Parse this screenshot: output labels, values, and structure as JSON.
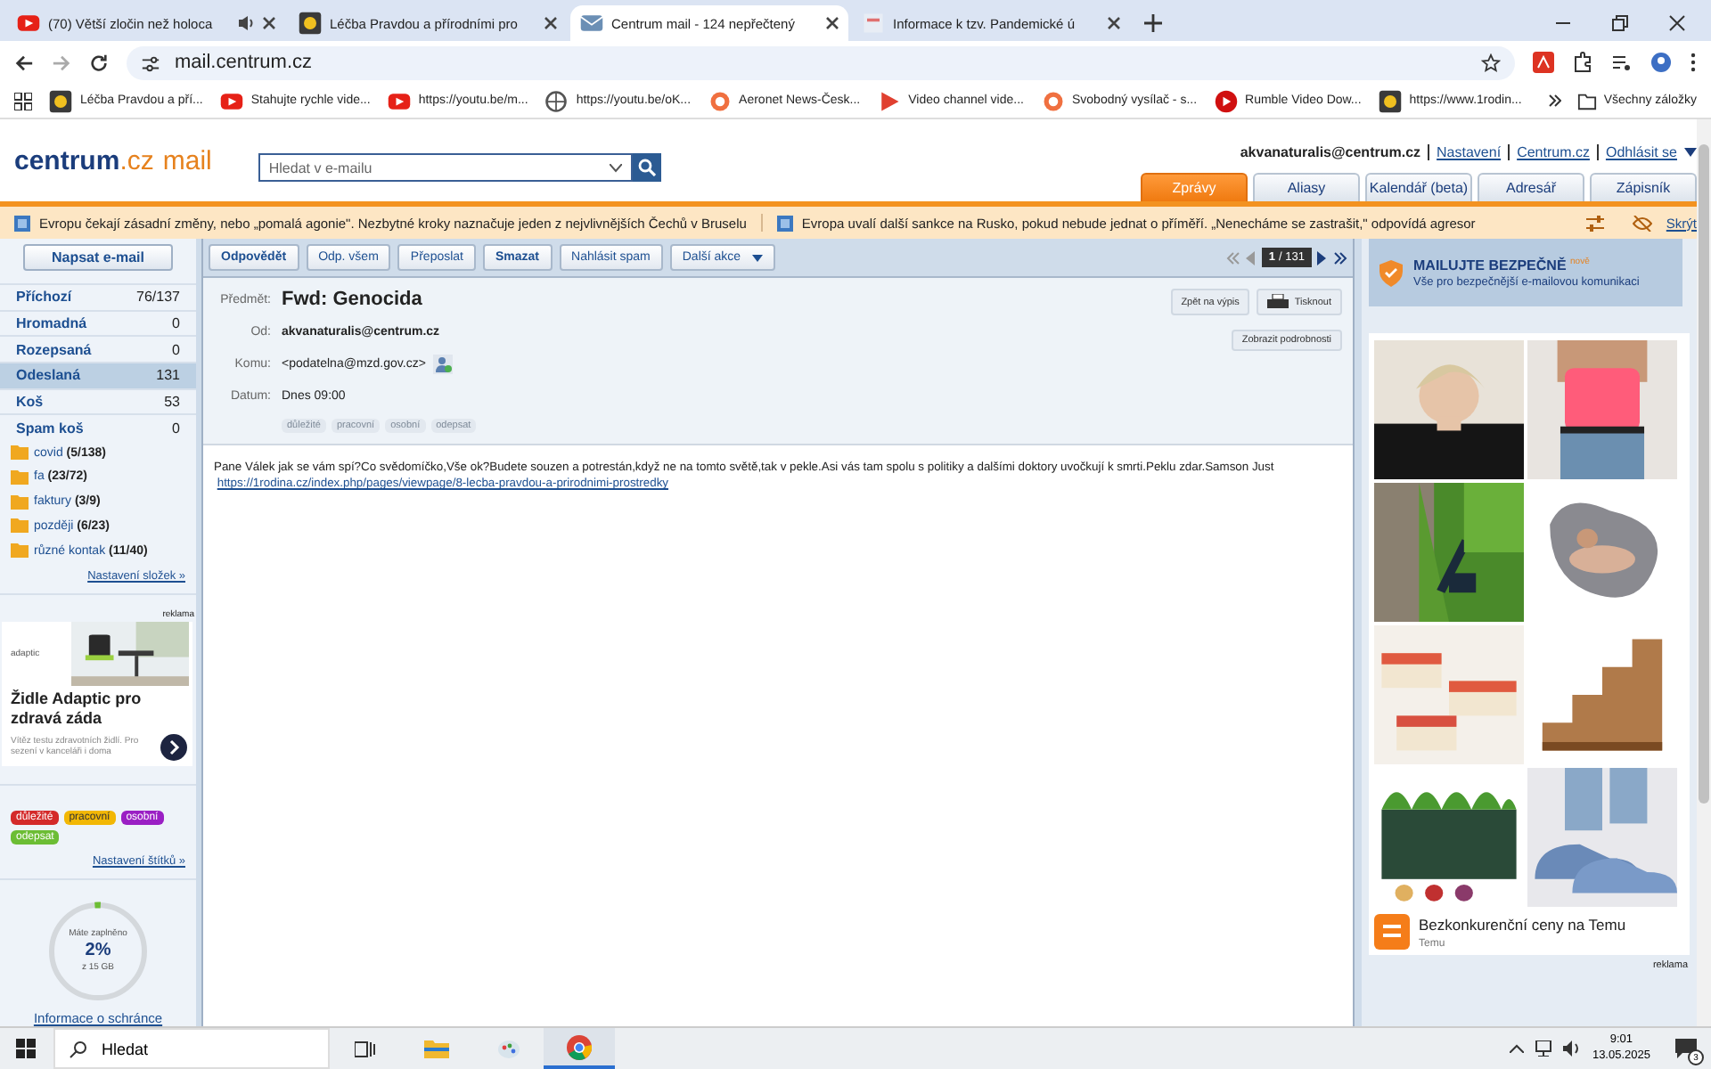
{
  "browser": {
    "tabs": [
      {
        "title": "(70) Větší zločin než holoca",
        "selected": false,
        "kind": "video",
        "audio": true
      },
      {
        "title": "Léčba Pravdou a přírodními pro",
        "selected": false,
        "kind": "site",
        "audio": false
      },
      {
        "title": "Centrum mail - 124 nepřečtený",
        "selected": true,
        "kind": "mail",
        "audio": false
      },
      {
        "title": "Informace k tzv. Pandemické ú",
        "selected": false,
        "kind": "doc",
        "audio": false
      }
    ],
    "address": "mail.centrum.cz",
    "bookmarks": [
      {
        "label": "Léčba Pravdou a pří...",
        "kind": "site"
      },
      {
        "label": "Stahujte rychle vide...",
        "kind": "video"
      },
      {
        "label": "https://youtu.be/m...",
        "kind": "video"
      },
      {
        "label": "https://youtu.be/oK...",
        "kind": "globe"
      },
      {
        "label": "Aeronet News-Česk...",
        "kind": "star"
      },
      {
        "label": "Video channel vide...",
        "kind": "play"
      },
      {
        "label": "Svobodný vysílač - s...",
        "kind": "star"
      },
      {
        "label": "Rumble Video Dow...",
        "kind": "rumble"
      },
      {
        "label": "https://www.1rodin...",
        "kind": "site"
      }
    ],
    "all_bookmarks": "Všechny záložky"
  },
  "header": {
    "logo": {
      "brand": "centrum",
      "domain": ".cz",
      "product": "mail"
    },
    "search": {
      "placeholder": "Hledat v e-mailu"
    },
    "user": "akvanaturalis@centrum.cz",
    "links": [
      "Nastavení",
      "Centrum.cz",
      "Odhlásit se"
    ],
    "nav": [
      {
        "label": "Zprávy",
        "selected": true
      },
      {
        "label": "Aliasy",
        "selected": false
      },
      {
        "label": "Kalendář (beta)",
        "selected": false
      },
      {
        "label": "Adresář",
        "selected": false
      },
      {
        "label": "Zápisník",
        "selected": false
      }
    ]
  },
  "news": {
    "items": [
      "Evropu čekají zásadní změny, nebo „pomalá agonie\". Nezbytné kroky naznačuje jeden z nejvlivnějších Čechů v Bruselu",
      "Evropa uvalí další sankce na Rusko, pokud nebude jednat o příměří. „Nenecháme se zastrašit,\" odpovídá agresor"
    ],
    "hide": "Skrýt"
  },
  "sidebar": {
    "compose": "Napsat e-mail",
    "folders": [
      {
        "name": "Příchozí",
        "count": "76/137",
        "selected": false
      },
      {
        "name": "Hromadná",
        "count": "0",
        "selected": false
      },
      {
        "name": "Rozepsaná",
        "count": "0",
        "selected": false
      },
      {
        "name": "Odeslaná",
        "count": "131",
        "selected": true
      },
      {
        "name": "Koš",
        "count": "53",
        "selected": false
      },
      {
        "name": "Spam koš",
        "count": "0",
        "selected": false
      }
    ],
    "custom_folders": [
      {
        "name": "covid",
        "count": "(5/138)"
      },
      {
        "name": "fa",
        "count": "(23/72)"
      },
      {
        "name": "faktury",
        "count": "(3/9)"
      },
      {
        "name": "později",
        "count": "(6/23)"
      },
      {
        "name": "různé kontak",
        "count": "(11/40)"
      }
    ],
    "folder_settings": "Nastavení složek »",
    "ad": {
      "label": "reklama",
      "advertiser": "adaptic",
      "headline": "Židle Adaptic pro zdravá záda",
      "body": "Vítěz testu zdravotních židlí. Pro sezení v kanceláři i doma"
    },
    "labels": [
      {
        "name": "důležité",
        "color": "#d42a2a"
      },
      {
        "name": "pracovní",
        "color": "#f2b705"
      },
      {
        "name": "osobní",
        "color": "#9a1fc4"
      },
      {
        "name": "odepsat",
        "color": "#6cbd34"
      }
    ],
    "label_settings": "Nastavení štítků »",
    "storage": {
      "caption": "Máte zaplněno",
      "percent": "2%",
      "total": "z 15 GB",
      "level": 0.02
    },
    "info": "Informace o schránce"
  },
  "toolbar": {
    "actions": [
      {
        "label": "Odpovědět",
        "bold": true
      },
      {
        "label": "Odp. všem",
        "bold": false
      },
      {
        "label": "Přeposlat",
        "bold": false
      },
      {
        "label": "Smazat",
        "bold": true
      },
      {
        "label": "Nahlásit spam",
        "bold": false
      }
    ],
    "more": "Další akce",
    "pager": {
      "current": "1",
      "total": "/ 131"
    }
  },
  "message": {
    "subject_label": "Předmět:",
    "subject": "Fwd: Genocida",
    "fields": [
      {
        "label": "Od:",
        "value": "akvanaturalis@centrum.cz",
        "bold": true,
        "contact": false
      },
      {
        "label": "Komu:",
        "value": "<podatelna@mzd.gov.cz>",
        "bold": false,
        "contact": true
      },
      {
        "label": "Datum:",
        "value": "Dnes 09:00",
        "bold": false,
        "contact": false
      }
    ],
    "back": "Zpět na výpis",
    "print": "Tisknout",
    "details": "Zobrazit podrobnosti",
    "tags": [
      "důležité",
      "pracovní",
      "osobní",
      "odepsat"
    ],
    "body": "Pane Válek jak se vám spí?Co svědomíčko,Vše ok?Budete souzen a potrestán,když ne na tomto světě,tak v pekle.Asi vás tam spolu s politiky a dalšími doktory uvočkují k smrti.Peklu zdar.Samson Just",
    "link": "https://1rodina.cz/index.php/pages/viewpage/8-lecba-pravdou-a-prirodnimi-prostredky"
  },
  "right": {
    "promo": {
      "title": "MAILUJTE BEZPEČNĚ",
      "badge": "nově",
      "text": "Vše pro bezpečnější e-mailovou komunikaci"
    },
    "ad": {
      "headline": "Bezkonkurenční ceny na Temu",
      "source": "Temu",
      "label": "reklama"
    }
  },
  "taskbar": {
    "search": "Hledat",
    "time": "9:01",
    "date": "13.05.2025",
    "notifications": "3"
  }
}
